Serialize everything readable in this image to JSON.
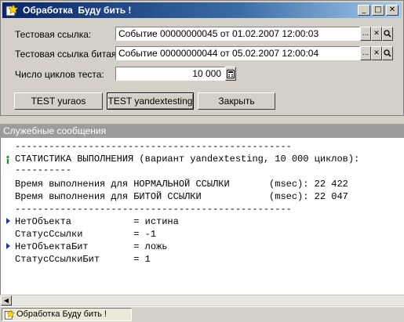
{
  "window": {
    "title": "Обработка  Буду бить !",
    "minimize_glyph": "_",
    "maximize_glyph": "□",
    "close_glyph": "✕"
  },
  "form": {
    "test_link_label": "Тестовая ссылка:",
    "test_link_value": "Событие 00000000045 от 01.02.2007 12:00:03",
    "broken_link_label": "Тестовая ссылка битая:",
    "broken_link_value": "Событие 00000000044 от 05.02.2007 12:00:04",
    "cycles_label": "Число циклов теста:",
    "cycles_value": "10 000",
    "select_glyph": "...",
    "clear_glyph": "✕",
    "open_glyph": "🔍"
  },
  "buttons": {
    "test_yuraos": "TEST yuraos",
    "test_yandextesting": "TEST yandextesting",
    "close": "Закрыть"
  },
  "messages": {
    "header": "Служебные сообщения",
    "lines": [
      "-------------------------------------------------",
      "СТАТИСТИКА ВЫПОЛНЕНИЯ (вариант yandextesting, 10 000 циклов):",
      "----------",
      "Время выполнения для НОРМАЛЬНОЙ ССЫЛКИ       (msec): 22 422",
      "Время выполнения для БИТОЙ ССЫЛКИ            (msec): 22 047",
      "-------------------------------------------------",
      "НетОбъекта           = истина",
      "СтатусСсылки         = -1",
      "НетОбъектаБит        = ложь",
      "СтатусСсылкиБит      = 1"
    ]
  },
  "taskbar": {
    "item": "Обработка  Буду бить !"
  }
}
